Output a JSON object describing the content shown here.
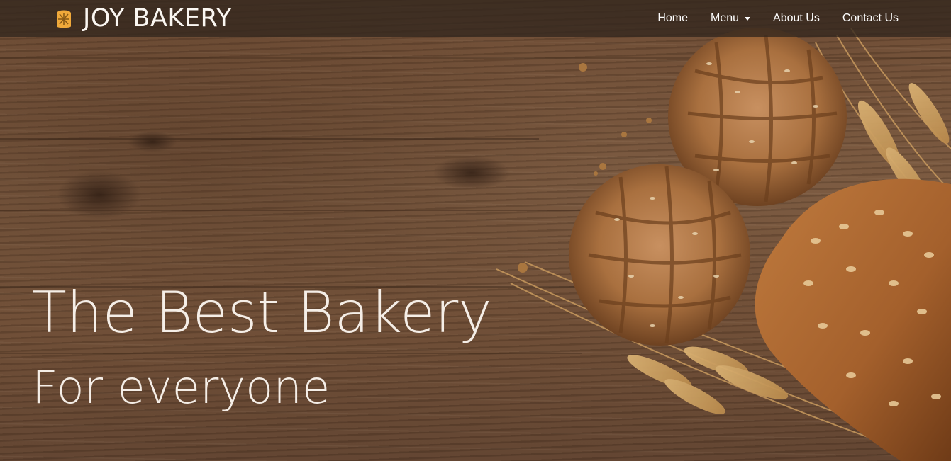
{
  "brand": {
    "name": "JOY BAKERY",
    "icon": "bread-loaf-icon",
    "icon_color": "#f0a93a"
  },
  "nav": {
    "items": [
      {
        "label": "Home"
      },
      {
        "label": "Menu",
        "has_dropdown": true
      },
      {
        "label": "About Us"
      },
      {
        "label": "Contact Us"
      }
    ]
  },
  "hero": {
    "headline": "The Best Bakery",
    "subheadline": "For everyone"
  },
  "colors": {
    "navbar_bg": "#32261e",
    "hero_text": "#f5eee7",
    "wood": "#6e4e37"
  }
}
